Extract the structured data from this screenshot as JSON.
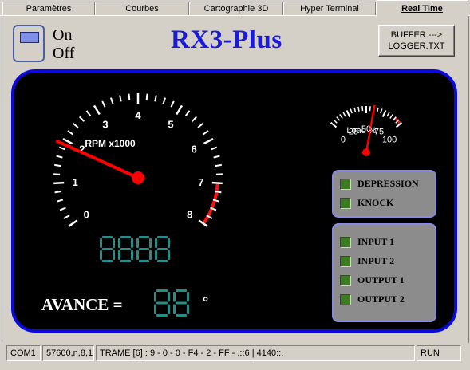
{
  "tabs": [
    {
      "label": "Paramètres"
    },
    {
      "label": "Courbes"
    },
    {
      "label": "Cartographie 3D"
    },
    {
      "label": "Hyper Terminal"
    },
    {
      "label": "Real Time",
      "active": true
    }
  ],
  "header": {
    "switch_on_label": "On",
    "switch_off_label": "Off",
    "app_title": "RX3-Plus",
    "buffer_button_line1": "BUFFER --->",
    "buffer_button_line2": "LOGGER.TXT"
  },
  "rpm_gauge": {
    "title": "RPM x1000",
    "scale_min": 0,
    "scale_max": 8,
    "tick_labels": [
      "0",
      "1",
      "2",
      "3",
      "4",
      "5",
      "6",
      "7",
      "8"
    ],
    "redline_from": 7,
    "needle_value": 1.9,
    "needle_color": "#ff0000",
    "digital_display": "8888"
  },
  "load_gauge": {
    "title": "Load %",
    "tick_labels": [
      "0",
      "25",
      "50",
      "75",
      "100"
    ],
    "needle_value": 60,
    "redline_from": 90
  },
  "avance": {
    "label": "AVANCE =",
    "display": "88",
    "unit": "°"
  },
  "indicators_top": [
    {
      "label": "DEPRESSION"
    },
    {
      "label": "KNOCK"
    }
  ],
  "indicators_io": [
    {
      "label": "INPUT 1"
    },
    {
      "label": "INPUT 2"
    },
    {
      "label": "OUTPUT 1"
    },
    {
      "label": "OUTPUT 2"
    }
  ],
  "colors": {
    "dash_border": "#0a0adc",
    "segment_digit": "#2a8c86",
    "title_blue": "#1a1adc",
    "lamp_green": "#3c7a22"
  },
  "statusbar": {
    "port": "COM1",
    "settings": "57600,n,8,1",
    "frame": "TRAME [6] : 9 - 0 - 0 - F4 - 2 - FF -   .::6 | 4140::.",
    "state": "RUN"
  }
}
